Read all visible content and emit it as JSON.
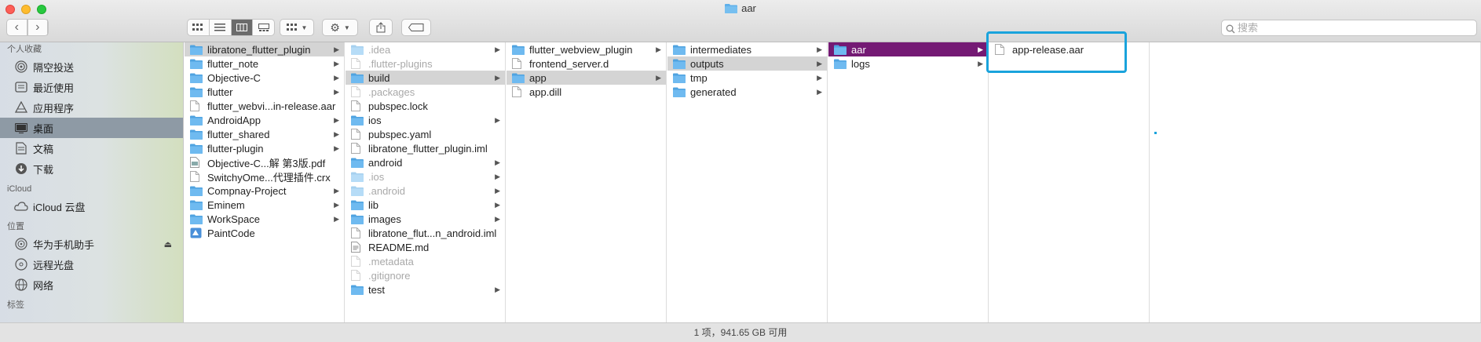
{
  "window": {
    "title": "aar"
  },
  "toolbar": {
    "back_icon": "chevron-left-icon",
    "forward_icon": "chevron-right-icon",
    "views": [
      "icon-view-icon",
      "list-view-icon",
      "column-view-icon",
      "gallery-view-icon"
    ],
    "active_view": 2,
    "search_placeholder": "搜索"
  },
  "sidebar": {
    "sections": [
      {
        "title": "个人收藏",
        "items": [
          {
            "label": "隔空投送",
            "icon": "airdrop-icon"
          },
          {
            "label": "最近使用",
            "icon": "recents-icon"
          },
          {
            "label": "应用程序",
            "icon": "applications-icon"
          },
          {
            "label": "桌面",
            "icon": "desktop-icon",
            "selected": true
          },
          {
            "label": "文稿",
            "icon": "documents-icon"
          },
          {
            "label": "下载",
            "icon": "downloads-icon"
          }
        ]
      },
      {
        "title": "iCloud",
        "items": [
          {
            "label": "iCloud 云盘",
            "icon": "cloud-icon"
          }
        ]
      },
      {
        "title": "位置",
        "items": [
          {
            "label": "华为手机助手",
            "icon": "disk-icon",
            "eject": true
          },
          {
            "label": "远程光盘",
            "icon": "disc-icon"
          },
          {
            "label": "网络",
            "icon": "network-icon"
          }
        ]
      },
      {
        "title": "标签",
        "items": []
      }
    ]
  },
  "columns": [
    {
      "items": [
        {
          "name": "libratone_flutter_plugin",
          "type": "folder",
          "arrow": true,
          "state": "hl"
        },
        {
          "name": "flutter_note",
          "type": "folder",
          "arrow": true
        },
        {
          "name": "Objective-C",
          "type": "folder",
          "arrow": true
        },
        {
          "name": "flutter",
          "type": "folder",
          "arrow": true
        },
        {
          "name": "flutter_webvi...in-release.aar",
          "type": "file"
        },
        {
          "name": "AndroidApp",
          "type": "folder",
          "arrow": true
        },
        {
          "name": "flutter_shared",
          "type": "folder",
          "arrow": true
        },
        {
          "name": "flutter-plugin",
          "type": "folder",
          "arrow": true
        },
        {
          "name": "Objective-C...解 第3版.pdf",
          "type": "pdf"
        },
        {
          "name": "SwitchyOme...代理插件.crx",
          "type": "file"
        },
        {
          "name": "Compnay-Project",
          "type": "folder",
          "arrow": true
        },
        {
          "name": "Eminem",
          "type": "folder",
          "arrow": true
        },
        {
          "name": "WorkSpace",
          "type": "folder",
          "arrow": true
        },
        {
          "name": "PaintCode",
          "type": "app"
        }
      ]
    },
    {
      "items": [
        {
          "name": ".idea",
          "type": "folder",
          "arrow": true,
          "state": "dim"
        },
        {
          "name": ".flutter-plugins",
          "type": "file",
          "state": "dim"
        },
        {
          "name": "build",
          "type": "folder",
          "arrow": true,
          "state": "hl"
        },
        {
          "name": ".packages",
          "type": "file",
          "state": "dim"
        },
        {
          "name": "pubspec.lock",
          "type": "file"
        },
        {
          "name": "ios",
          "type": "folder",
          "arrow": true
        },
        {
          "name": "pubspec.yaml",
          "type": "file"
        },
        {
          "name": "libratone_flutter_plugin.iml",
          "type": "file"
        },
        {
          "name": "android",
          "type": "folder",
          "arrow": true
        },
        {
          "name": ".ios",
          "type": "folder",
          "arrow": true,
          "state": "dim"
        },
        {
          "name": ".android",
          "type": "folder",
          "arrow": true,
          "state": "dim"
        },
        {
          "name": "lib",
          "type": "folder",
          "arrow": true
        },
        {
          "name": "images",
          "type": "folder",
          "arrow": true
        },
        {
          "name": "libratone_flut...n_android.iml",
          "type": "file"
        },
        {
          "name": "README.md",
          "type": "md"
        },
        {
          "name": ".metadata",
          "type": "file",
          "state": "dim"
        },
        {
          "name": ".gitignore",
          "type": "file",
          "state": "dim"
        },
        {
          "name": "test",
          "type": "folder",
          "arrow": true
        }
      ]
    },
    {
      "items": [
        {
          "name": "flutter_webview_plugin",
          "type": "folder",
          "arrow": true
        },
        {
          "name": "frontend_server.d",
          "type": "file"
        },
        {
          "name": "app",
          "type": "folder",
          "arrow": true,
          "state": "hl"
        },
        {
          "name": "app.dill",
          "type": "file"
        }
      ]
    },
    {
      "items": [
        {
          "name": "intermediates",
          "type": "folder",
          "arrow": true
        },
        {
          "name": "outputs",
          "type": "folder",
          "arrow": true,
          "state": "hl"
        },
        {
          "name": "tmp",
          "type": "folder",
          "arrow": true
        },
        {
          "name": "generated",
          "type": "folder",
          "arrow": true
        }
      ]
    },
    {
      "items": [
        {
          "name": "aar",
          "type": "folder",
          "arrow": true,
          "state": "sel"
        },
        {
          "name": "logs",
          "type": "folder",
          "arrow": true
        }
      ]
    },
    {
      "items": [
        {
          "name": "app-release.aar",
          "type": "file"
        }
      ]
    },
    {
      "items": []
    }
  ],
  "status": "1 项，941.65 GB 可用",
  "colors": {
    "selection": "#741a74",
    "highlight": "#d4d4d4",
    "folder": "#5fb0ea",
    "callout": "#1aa3dc"
  }
}
